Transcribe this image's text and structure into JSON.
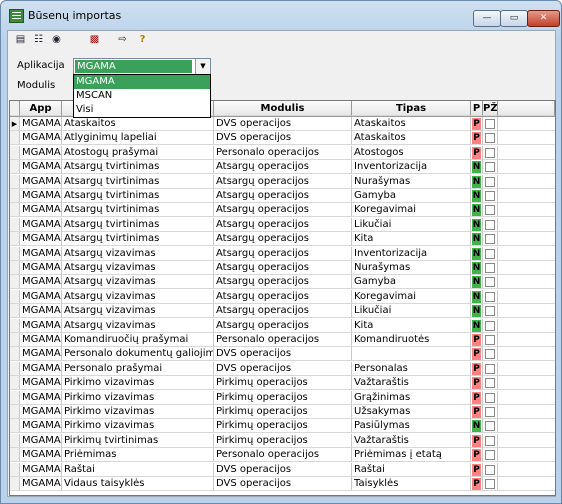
{
  "window": {
    "title": "Būsenų importas",
    "min_label": "—",
    "max_label": "▭",
    "close_label": "✕"
  },
  "toolbar": {
    "icons": [
      "new-icon",
      "tree-icon",
      "binoculars-icon",
      "import-icon",
      "export-icon",
      "help-icon"
    ]
  },
  "filters": {
    "aplikacija_label": "Aplikacija",
    "modulis_label": "Modulis",
    "aplikacija_value": "MGAMA",
    "options": [
      "MGAMA",
      "MSCAN",
      "Visi"
    ]
  },
  "grid": {
    "columns": [
      "App",
      "",
      "Modulis",
      "Tipas",
      "P",
      "PŽ"
    ],
    "rows": [
      {
        "app": "MGAMA",
        "name": "Ataskaitos",
        "module": "DVS operacijos",
        "type": "Ataskaitos",
        "p": "P"
      },
      {
        "app": "MGAMA",
        "name": "Atlyginimų lapeliai",
        "module": "DVS operacijos",
        "type": "Ataskaitos",
        "p": "P"
      },
      {
        "app": "MGAMA",
        "name": "Atostogų prašymai",
        "module": "Personalo operacijos",
        "type": "Atostogos",
        "p": "P"
      },
      {
        "app": "MGAMA",
        "name": "Atsargų tvirtinimas",
        "module": "Atsargų operacijos",
        "type": "Inventorizacija",
        "p": "N"
      },
      {
        "app": "MGAMA",
        "name": "Atsargų tvirtinimas",
        "module": "Atsargų operacijos",
        "type": "Nurašymas",
        "p": "N"
      },
      {
        "app": "MGAMA",
        "name": "Atsargų tvirtinimas",
        "module": "Atsargų operacijos",
        "type": "Gamyba",
        "p": "N"
      },
      {
        "app": "MGAMA",
        "name": "Atsargų tvirtinimas",
        "module": "Atsargų operacijos",
        "type": "Koregavimai",
        "p": "N"
      },
      {
        "app": "MGAMA",
        "name": "Atsargų tvirtinimas",
        "module": "Atsargų operacijos",
        "type": "Likučiai",
        "p": "N"
      },
      {
        "app": "MGAMA",
        "name": "Atsargų tvirtinimas",
        "module": "Atsargų operacijos",
        "type": "Kita",
        "p": "N"
      },
      {
        "app": "MGAMA",
        "name": "Atsargų vizavimas",
        "module": "Atsargų operacijos",
        "type": "Inventorizacija",
        "p": "N"
      },
      {
        "app": "MGAMA",
        "name": "Atsargų vizavimas",
        "module": "Atsargų operacijos",
        "type": "Nurašymas",
        "p": "N"
      },
      {
        "app": "MGAMA",
        "name": "Atsargų vizavimas",
        "module": "Atsargų operacijos",
        "type": "Gamyba",
        "p": "N"
      },
      {
        "app": "MGAMA",
        "name": "Atsargų vizavimas",
        "module": "Atsargų operacijos",
        "type": "Koregavimai",
        "p": "N"
      },
      {
        "app": "MGAMA",
        "name": "Atsargų vizavimas",
        "module": "Atsargų operacijos",
        "type": "Likučiai",
        "p": "N"
      },
      {
        "app": "MGAMA",
        "name": "Atsargų vizavimas",
        "module": "Atsargų operacijos",
        "type": "Kita",
        "p": "N"
      },
      {
        "app": "MGAMA",
        "name": "Komandiruočių prašymai",
        "module": "Personalo operacijos",
        "type": "Komandiruotės",
        "p": "P"
      },
      {
        "app": "MGAMA",
        "name": "Personalo dokumentų galiojimas",
        "module": "DVS operacijos",
        "type": "",
        "p": "P"
      },
      {
        "app": "MGAMA",
        "name": "Personalo prašymai",
        "module": "DVS operacijos",
        "type": "Personalas",
        "p": "P"
      },
      {
        "app": "MGAMA",
        "name": "Pirkimo vizavimas",
        "module": "Pirkimų operacijos",
        "type": "Važtaraštis",
        "p": "P"
      },
      {
        "app": "MGAMA",
        "name": "Pirkimo vizavimas",
        "module": "Pirkimų operacijos",
        "type": "Grąžinimas",
        "p": "P"
      },
      {
        "app": "MGAMA",
        "name": "Pirkimo vizavimas",
        "module": "Pirkimų operacijos",
        "type": "Užsakymas",
        "p": "P"
      },
      {
        "app": "MGAMA",
        "name": "Pirkimo vizavimas",
        "module": "Pirkimų operacijos",
        "type": "Pasiūlymas",
        "p": "N"
      },
      {
        "app": "MGAMA",
        "name": "Pirkimų tvirtinimas",
        "module": "Pirkimų operacijos",
        "type": "Važtaraštis",
        "p": "P"
      },
      {
        "app": "MGAMA",
        "name": "Priėmimas",
        "module": "Personalo operacijos",
        "type": "Priėmimas į etatą",
        "p": "P"
      },
      {
        "app": "MGAMA",
        "name": "Raštai",
        "module": "DVS operacijos",
        "type": "Raštai",
        "p": "P"
      },
      {
        "app": "MGAMA",
        "name": "Vidaus taisyklės",
        "module": "DVS operacijos",
        "type": "Taisyklės",
        "p": "P"
      }
    ]
  },
  "colors": {
    "selection": "#3aa05a",
    "p_badge": "#ff8080",
    "n_badge": "#3fb34a"
  }
}
